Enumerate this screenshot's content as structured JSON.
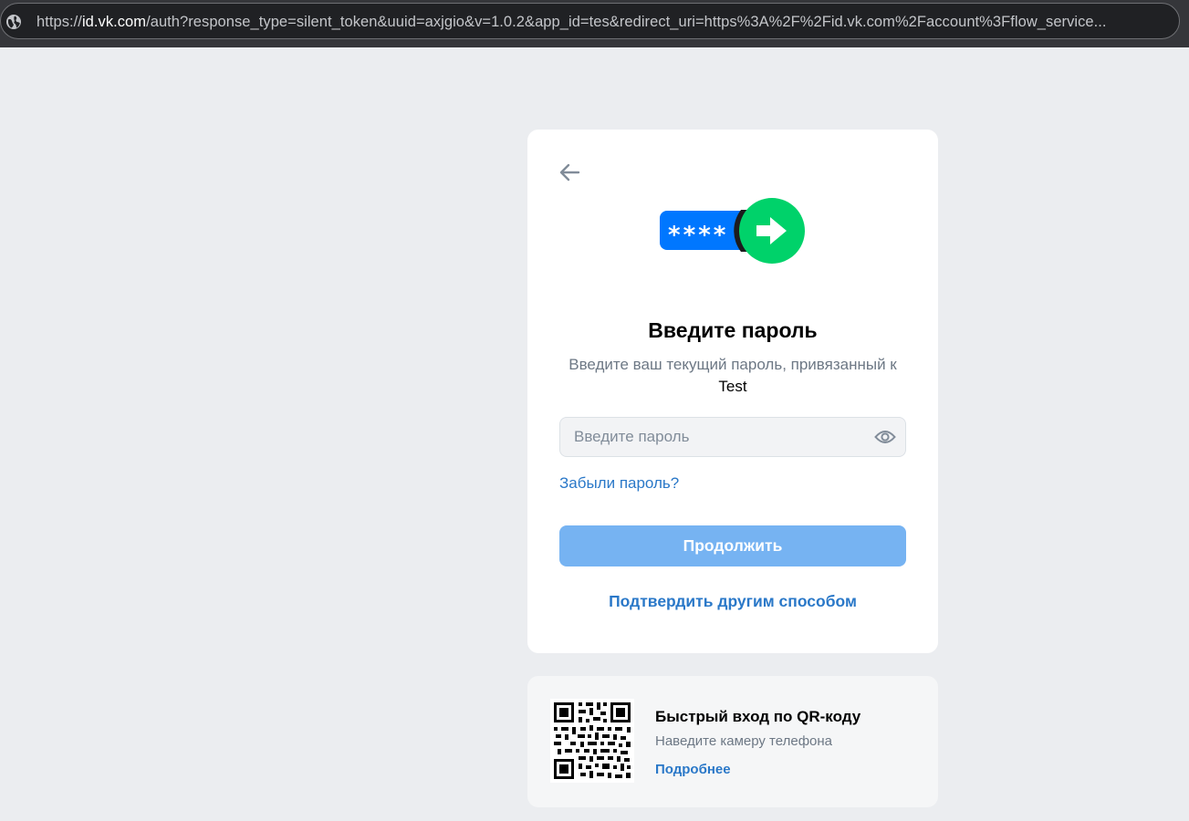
{
  "browser": {
    "url_prefix": "https://",
    "url_host": "id.vk.com",
    "url_rest": "/auth?response_type=silent_token&uuid=axjgio&v=1.0.2&app_id=tes&redirect_uri=https%3A%2F%2Fid.vk.com%2Faccount%3Fflow_service...",
    "site_icon": "globe-icon"
  },
  "card": {
    "back_icon": "arrow-left-icon",
    "illustration": {
      "masked_text": "****",
      "colors": {
        "field": "#0077ff",
        "arrow_circle": "#00d26a"
      }
    },
    "title": "Введите пароль",
    "subtitle_text": "Введите ваш текущий пароль, привязанный к",
    "account_name": "Test",
    "password_placeholder": "Введите пароль",
    "eye_icon": "eye-icon",
    "forgot_link": "Забыли пароль?",
    "continue_button": "Продолжить",
    "other_method_link": "Подтвердить другим способом"
  },
  "qr_login": {
    "title": "Быстрый вход по QR-коду",
    "description": "Наведите камеру телефона",
    "more_link": "Подробнее",
    "icon": "qr-code-icon"
  },
  "colors": {
    "accent": "#2a78c8",
    "button_disabled": "#76b3f2",
    "page_background": "#ebedf0"
  }
}
